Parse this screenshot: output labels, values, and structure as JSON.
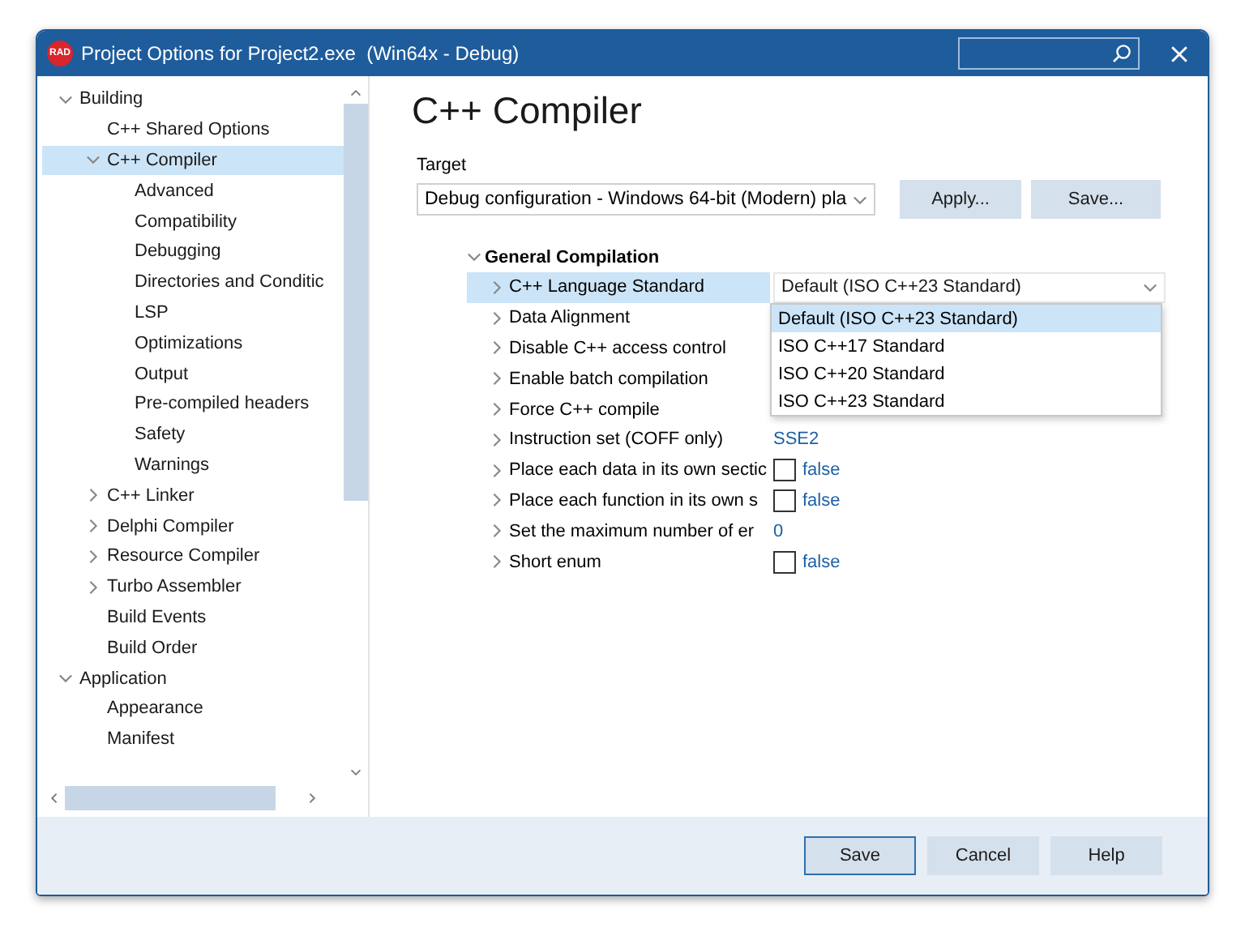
{
  "window": {
    "title": "Project Options for Project2.exe  (Win64x - Debug)",
    "logo": "RAD"
  },
  "tree": [
    {
      "label": "Building",
      "expanded": true,
      "selected": false,
      "children": [
        {
          "label": "C++ Shared Options",
          "selected": false
        },
        {
          "label": "C++ Compiler",
          "expanded": true,
          "selected": true,
          "children": [
            {
              "label": "Advanced",
              "selected": false
            },
            {
              "label": "Compatibility",
              "selected": false
            },
            {
              "label": "Debugging",
              "selected": false
            },
            {
              "label": "Directories and Conditic",
              "selected": false
            },
            {
              "label": "LSP",
              "selected": false
            },
            {
              "label": "Optimizations",
              "selected": false
            },
            {
              "label": "Output",
              "selected": false
            },
            {
              "label": "Pre-compiled headers",
              "selected": false
            },
            {
              "label": "Safety",
              "selected": false
            },
            {
              "label": "Warnings",
              "selected": false
            }
          ]
        },
        {
          "label": "C++ Linker",
          "expanded": false,
          "selected": false
        },
        {
          "label": "Delphi Compiler",
          "expanded": false,
          "selected": false
        },
        {
          "label": "Resource Compiler",
          "expanded": false,
          "selected": false
        },
        {
          "label": "Turbo Assembler",
          "expanded": false,
          "selected": false
        },
        {
          "label": "Build Events",
          "selected": false
        },
        {
          "label": "Build Order",
          "selected": false
        }
      ]
    },
    {
      "label": "Application",
      "expanded": true,
      "selected": false,
      "children": [
        {
          "label": "Appearance",
          "selected": false
        },
        {
          "label": "Manifest",
          "selected": false
        }
      ]
    }
  ],
  "page_title": "C++ Compiler",
  "target": {
    "label": "Target",
    "value": "Debug configuration - Windows 64-bit (Modern) pla",
    "buttons": [
      "Apply...",
      "Save..."
    ]
  },
  "group": {
    "label": "General Compilation",
    "expanded": true
  },
  "properties": [
    {
      "name": "C++ Language Standard",
      "kind": "combo",
      "value": "Default (ISO C++23 Standard)",
      "selected": true
    },
    {
      "name": "Data Alignment",
      "kind": "hidden",
      "selected": false
    },
    {
      "name": "Disable C++ access control",
      "kind": "hidden",
      "selected": false
    },
    {
      "name": "Enable batch compilation",
      "kind": "hidden",
      "selected": false
    },
    {
      "name": "Force C++ compile",
      "kind": "hidden",
      "selected": false
    },
    {
      "name": "Instruction set (COFF only)",
      "kind": "text",
      "value": "SSE2",
      "selected": false
    },
    {
      "name": "Place each data in its own sectic",
      "kind": "checkbox",
      "value": "false",
      "checked": false,
      "selected": false
    },
    {
      "name": "Place each function in its own s",
      "kind": "checkbox",
      "value": "false",
      "checked": false,
      "selected": false
    },
    {
      "name": "Set the maximum number of er",
      "kind": "text",
      "value": "0",
      "selected": false
    },
    {
      "name": "Short enum",
      "kind": "checkbox",
      "value": "false",
      "checked": false,
      "selected": false
    }
  ],
  "dropdown": [
    {
      "label": "Default (ISO C++23 Standard)",
      "selected": true
    },
    {
      "label": "ISO C++17 Standard",
      "selected": false
    },
    {
      "label": "ISO C++20 Standard",
      "selected": false
    },
    {
      "label": "ISO C++23 Standard",
      "selected": false
    }
  ],
  "footer_buttons": [
    {
      "label": "Save",
      "default": true
    },
    {
      "label": "Cancel",
      "default": false
    },
    {
      "label": "Help",
      "default": false
    }
  ]
}
